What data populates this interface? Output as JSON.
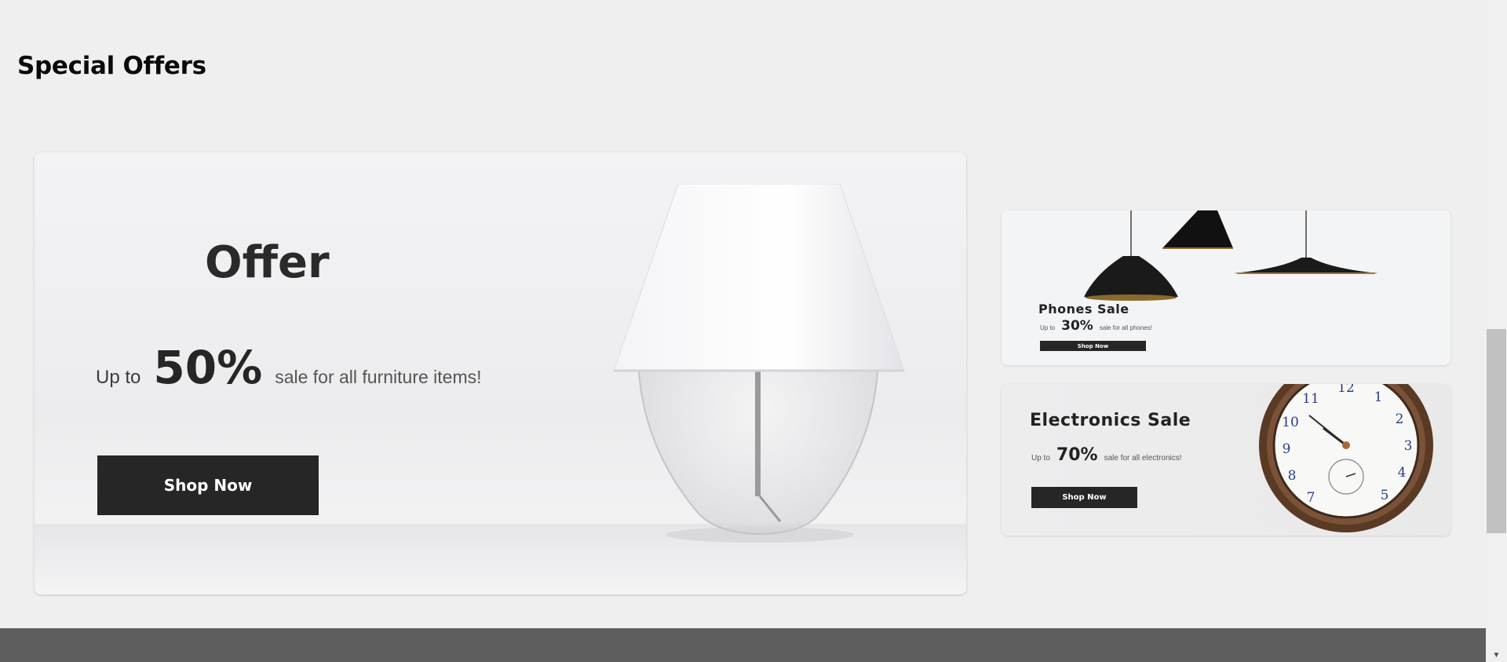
{
  "section": {
    "title": "Special Offers"
  },
  "main_offer": {
    "title": "Offer",
    "up_to": "Up to",
    "percent": "50%",
    "description": "sale for all furniture items!",
    "button": "Shop Now"
  },
  "phones_offer": {
    "title": "Phones Sale",
    "up_to": "Up to",
    "percent": "30%",
    "description": "sale for all phones!",
    "button": "Shop Now"
  },
  "electronics_offer": {
    "title": "Electronics Sale",
    "up_to": "Up to",
    "percent": "70%",
    "description": "sale for all electronics!",
    "button": "Shop Now"
  },
  "colors": {
    "background": "#efefef",
    "button": "#262626",
    "footer": "#5f5e5f"
  },
  "icons": {
    "scroll_down": "chevron-down-icon"
  }
}
